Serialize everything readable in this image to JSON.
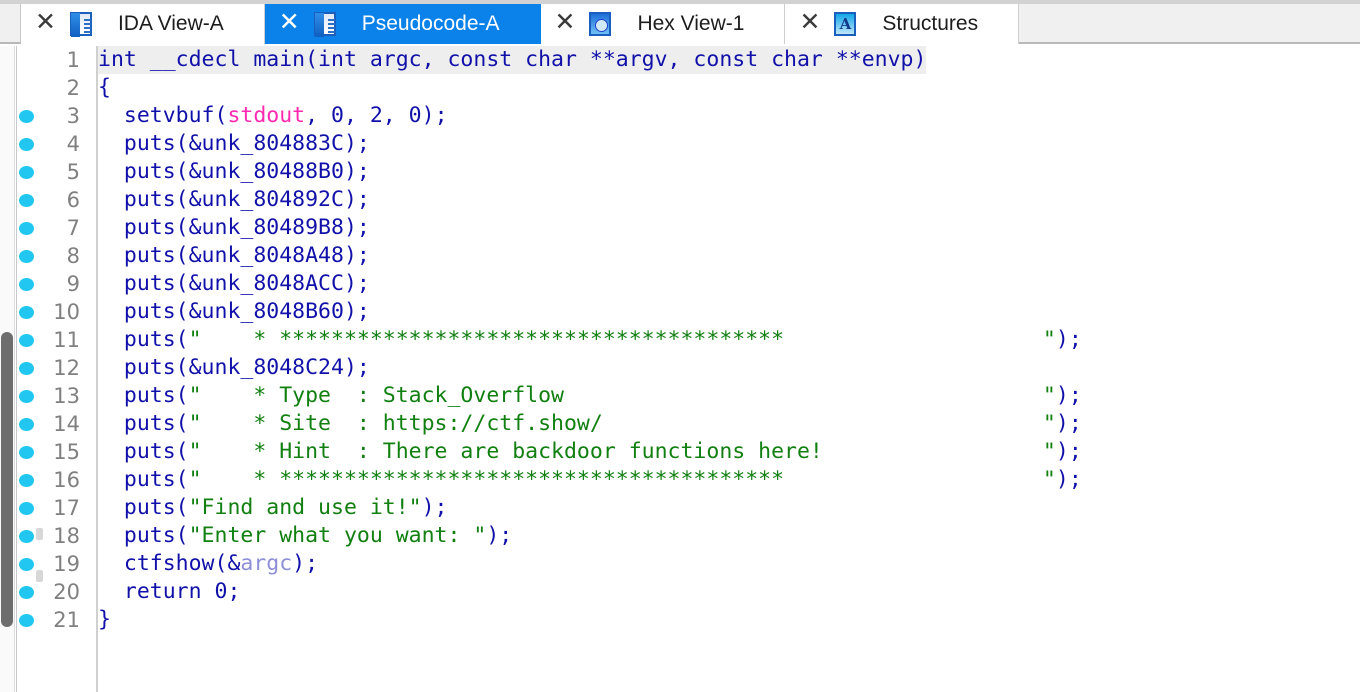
{
  "window": {
    "app": "IDA Pro",
    "active_view": "Pseudocode-A"
  },
  "tabs": [
    {
      "label": "IDA View-A",
      "icon": "document-icon",
      "icon_kind": "doc",
      "active": false,
      "close": "✕"
    },
    {
      "label": "Pseudocode-A",
      "icon": "document-icon",
      "icon_kind": "doc",
      "active": true,
      "close": "✕"
    },
    {
      "label": "Hex View-1",
      "icon": "hex-view-icon",
      "icon_kind": "hex",
      "active": false,
      "close": "✕"
    },
    {
      "label": "Structures",
      "icon": "structures-icon",
      "icon_kind": "struct",
      "active": false,
      "close": "✕",
      "glyph": "A"
    }
  ],
  "colors": {
    "active_tab": "#0b82ea",
    "keyword": "#1111aa",
    "string": "#118011",
    "global_var": "#ff2ab0",
    "local_var": "#8f8fd8",
    "breakpoint_dot": "#21c7f0",
    "line_number": "#808080",
    "current_line_highlight": "#eeeeee"
  },
  "editor": {
    "function_signature": "int __cdecl main(int argc, const char **argv, const char **envp)",
    "current_line": 1,
    "first_line": 1,
    "last_line": 21,
    "lines": [
      {
        "n": 1,
        "bp": false,
        "highlight": true,
        "spans": [
          {
            "t": "int __cdecl main(int argc, const char **argv, const char **envp)",
            "c": "c-kw"
          }
        ]
      },
      {
        "n": 2,
        "bp": false,
        "highlight": false,
        "spans": [
          {
            "t": "{",
            "c": "c-kw"
          }
        ]
      },
      {
        "n": 3,
        "bp": true,
        "highlight": false,
        "spans": [
          {
            "t": "  setvbuf(",
            "c": "c-kw"
          },
          {
            "t": "stdout",
            "c": "c-pink"
          },
          {
            "t": ", 0, 2, 0);",
            "c": "c-kw"
          }
        ]
      },
      {
        "n": 4,
        "bp": true,
        "highlight": false,
        "spans": [
          {
            "t": "  puts(&unk_804883C);",
            "c": "c-kw"
          }
        ]
      },
      {
        "n": 5,
        "bp": true,
        "highlight": false,
        "spans": [
          {
            "t": "  puts(&unk_80488B0);",
            "c": "c-kw"
          }
        ]
      },
      {
        "n": 6,
        "bp": true,
        "highlight": false,
        "spans": [
          {
            "t": "  puts(&unk_804892C);",
            "c": "c-kw"
          }
        ]
      },
      {
        "n": 7,
        "bp": true,
        "highlight": false,
        "spans": [
          {
            "t": "  puts(&unk_80489B8);",
            "c": "c-kw"
          }
        ]
      },
      {
        "n": 8,
        "bp": true,
        "highlight": false,
        "spans": [
          {
            "t": "  puts(&unk_8048A48);",
            "c": "c-kw"
          }
        ]
      },
      {
        "n": 9,
        "bp": true,
        "highlight": false,
        "spans": [
          {
            "t": "  puts(&unk_8048ACC);",
            "c": "c-kw"
          }
        ]
      },
      {
        "n": 10,
        "bp": true,
        "highlight": false,
        "spans": [
          {
            "t": "  puts(&unk_8048B60);",
            "c": "c-kw"
          }
        ]
      },
      {
        "n": 11,
        "bp": true,
        "highlight": false,
        "spans": [
          {
            "t": "  puts(",
            "c": "c-kw"
          },
          {
            "t": "\"    * ***************************************                    \"",
            "c": "c-str"
          },
          {
            "t": ");",
            "c": "c-kw"
          }
        ]
      },
      {
        "n": 12,
        "bp": true,
        "highlight": false,
        "spans": [
          {
            "t": "  puts(&unk_8048C24);",
            "c": "c-kw"
          }
        ]
      },
      {
        "n": 13,
        "bp": true,
        "highlight": false,
        "spans": [
          {
            "t": "  puts(",
            "c": "c-kw"
          },
          {
            "t": "\"    * Type  : Stack_Overflow                                     \"",
            "c": "c-str"
          },
          {
            "t": ");",
            "c": "c-kw"
          }
        ]
      },
      {
        "n": 14,
        "bp": true,
        "highlight": false,
        "spans": [
          {
            "t": "  puts(",
            "c": "c-kw"
          },
          {
            "t": "\"    * Site  : https://ctf.show/                                  \"",
            "c": "c-str"
          },
          {
            "t": ");",
            "c": "c-kw"
          }
        ]
      },
      {
        "n": 15,
        "bp": true,
        "highlight": false,
        "spans": [
          {
            "t": "  puts(",
            "c": "c-kw"
          },
          {
            "t": "\"    * Hint  : There are backdoor functions here!                 \"",
            "c": "c-str"
          },
          {
            "t": ");",
            "c": "c-kw"
          }
        ]
      },
      {
        "n": 16,
        "bp": true,
        "highlight": false,
        "spans": [
          {
            "t": "  puts(",
            "c": "c-kw"
          },
          {
            "t": "\"    * ***************************************                    \"",
            "c": "c-str"
          },
          {
            "t": ");",
            "c": "c-kw"
          }
        ]
      },
      {
        "n": 17,
        "bp": true,
        "highlight": false,
        "spans": [
          {
            "t": "  puts(",
            "c": "c-kw"
          },
          {
            "t": "\"Find and use it!\"",
            "c": "c-str"
          },
          {
            "t": ");",
            "c": "c-kw"
          }
        ]
      },
      {
        "n": 18,
        "bp": true,
        "highlight": false,
        "spans": [
          {
            "t": "  puts(",
            "c": "c-kw"
          },
          {
            "t": "\"Enter what you want: \"",
            "c": "c-str"
          },
          {
            "t": ");",
            "c": "c-kw"
          }
        ]
      },
      {
        "n": 19,
        "bp": true,
        "highlight": false,
        "spans": [
          {
            "t": "  ctfshow(&",
            "c": "c-kw"
          },
          {
            "t": "argc",
            "c": "c-var"
          },
          {
            "t": ");",
            "c": "c-kw"
          }
        ]
      },
      {
        "n": 20,
        "bp": true,
        "highlight": false,
        "spans": [
          {
            "t": "  return 0;",
            "c": "c-kw"
          }
        ]
      },
      {
        "n": 21,
        "bp": true,
        "highlight": false,
        "spans": [
          {
            "t": "}",
            "c": "c-kw"
          }
        ]
      }
    ]
  },
  "scrollbar": {
    "orientation": "vertical",
    "thumb_top_pct": 44,
    "thumb_height_pct": 46
  }
}
